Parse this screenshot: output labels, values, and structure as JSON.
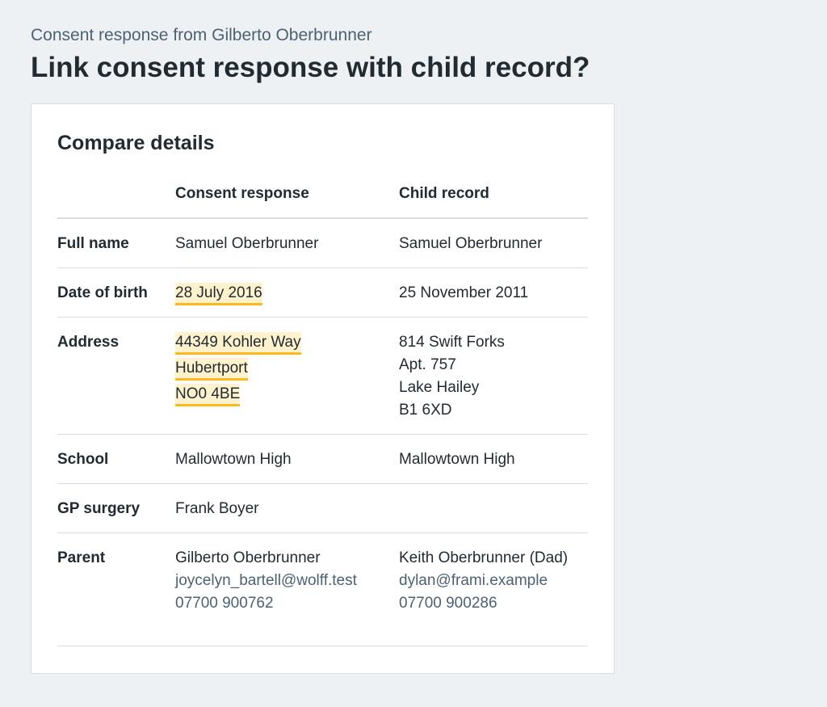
{
  "header": {
    "caption": "Consent response from Gilberto Oberbrunner",
    "title": "Link consent response with child record?"
  },
  "card": {
    "title": "Compare details",
    "columns": {
      "consent": "Consent response",
      "child": "Child record"
    },
    "rows": {
      "full_name": {
        "label": "Full name",
        "consent": "Samuel Oberbrunner",
        "child": "Samuel Oberbrunner"
      },
      "dob": {
        "label": "Date of birth",
        "consent": "28 July 2016",
        "child": "25 November 2011"
      },
      "address": {
        "label": "Address",
        "consent": [
          "44349 Kohler Way",
          "Hubertport",
          "NO0 4BE"
        ],
        "child": [
          "814 Swift Forks",
          "Apt. 757",
          "Lake Hailey",
          "B1 6XD"
        ]
      },
      "school": {
        "label": "School",
        "consent": "Mallowtown High",
        "child": "Mallowtown High"
      },
      "gp": {
        "label": "GP surgery",
        "consent": "Frank Boyer",
        "child": ""
      },
      "parent": {
        "label": "Parent",
        "consent": {
          "name": "Gilberto Oberbrunner",
          "email": "joycelyn_bartell@wolff.test",
          "phone": "07700 900762"
        },
        "child": {
          "name": "Keith Oberbrunner (Dad)",
          "email": "dylan@frami.example",
          "phone": "07700 900286"
        }
      }
    }
  },
  "colors": {
    "background": "#eef1f4",
    "text": "#212b32",
    "secondary_text": "#4c6272",
    "highlight_bg": "#fff2cc",
    "highlight_border": "#ffb81c",
    "divider": "#d8dde0"
  }
}
